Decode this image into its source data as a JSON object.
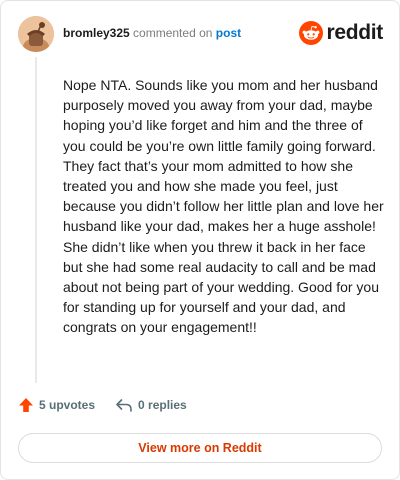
{
  "comment": {
    "username": "bromley325",
    "action_text": "commented on",
    "post_link": "post",
    "body": "Nope NTA. Sounds like you mom and her husband purposely moved you away from your dad, maybe hoping you’d like forget and him and the three of you could be you’re own little family going forward. They fact that’s your mom admitted to how she treated you and how she made you feel, just because you didn’t follow her little plan and love her husband like your dad, makes her a huge asshole! She didn’t like when you threw it back in her face but she had some real audacity to call and be mad about not being part of your wedding. Good for you for standing up for yourself and your dad, and congrats on your engagement!!",
    "upvotes_label": "5 upvotes",
    "replies_label": "0 replies"
  },
  "brand": {
    "name": "reddit",
    "logo_icon": "reddit-snoo-icon",
    "accent_color": "#ff4500"
  },
  "footer": {
    "view_more_label": "View more on Reddit"
  },
  "colors": {
    "upvote": "#ff4500",
    "link": "#0079d3",
    "view_more_text": "#d93a00"
  }
}
